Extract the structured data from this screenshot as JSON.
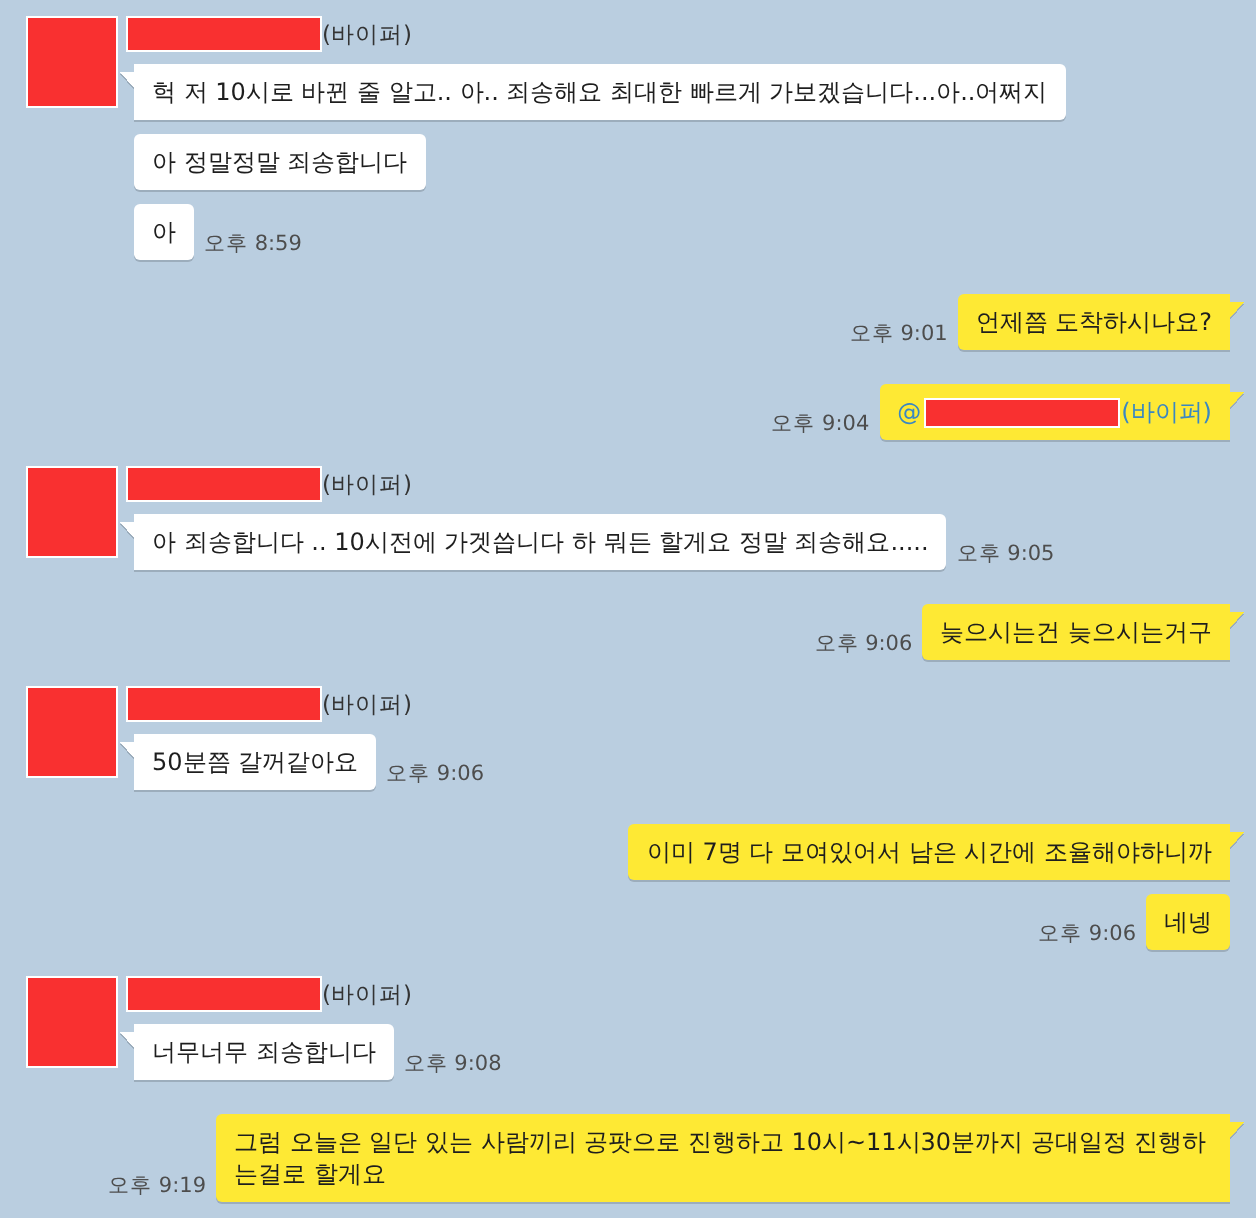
{
  "chat": [
    {
      "kind": "received",
      "sender": {
        "suffix": "(바이퍼)"
      },
      "bubbles": [
        {
          "kind": "text",
          "text": "헉 저 10시로 바뀐 줄 알고.. 아.. 죄송해요 최대한 빠르게 가보겠습니다...아..어쩌지"
        },
        {
          "kind": "text",
          "text": "아 정말정말 죄송합니다"
        },
        {
          "kind": "text",
          "text": "아",
          "time": "오후 8:59"
        }
      ]
    },
    {
      "kind": "sent",
      "bubbles": [
        {
          "kind": "text",
          "text": "언제쯤 도착하시나요?",
          "time": "오후 9:01"
        }
      ]
    },
    {
      "kind": "sent",
      "bubbles": [
        {
          "kind": "mention",
          "prefix": "@",
          "suffix": "(바이퍼)",
          "time": "오후 9:04"
        }
      ]
    },
    {
      "kind": "received",
      "sender": {
        "suffix": "(바이퍼)"
      },
      "bubbles": [
        {
          "kind": "text",
          "text": "아 죄송합니다 .. 10시전에 가겟씁니다 하 뭐든 할게요 정말 죄송해요.....",
          "time": "오후 9:05"
        }
      ]
    },
    {
      "kind": "sent",
      "bubbles": [
        {
          "kind": "text",
          "text": "늦으시는건 늦으시는거구",
          "time": "오후 9:06"
        }
      ]
    },
    {
      "kind": "received",
      "sender": {
        "suffix": "(바이퍼)"
      },
      "bubbles": [
        {
          "kind": "text",
          "text": "50분쯤 갈꺼같아요",
          "time": "오후 9:06"
        }
      ]
    },
    {
      "kind": "sent",
      "bubbles": [
        {
          "kind": "text",
          "text": "이미 7명 다 모여있어서 남은 시간에 조율해야하니까"
        },
        {
          "kind": "text",
          "text": "네넹",
          "time": "오후 9:06"
        }
      ]
    },
    {
      "kind": "received",
      "sender": {
        "suffix": "(바이퍼)"
      },
      "bubbles": [
        {
          "kind": "text",
          "text": "너무너무 죄송합니다",
          "time": "오후 9:08"
        }
      ]
    },
    {
      "kind": "sent",
      "bubbles": [
        {
          "kind": "text",
          "text": "그럼 오늘은 일단 있는 사람끼리 공팟으로 진행하고 10시~11시30분까지 공대일정 진행하는걸로 할게요",
          "time": "오후 9:19"
        }
      ]
    }
  ]
}
